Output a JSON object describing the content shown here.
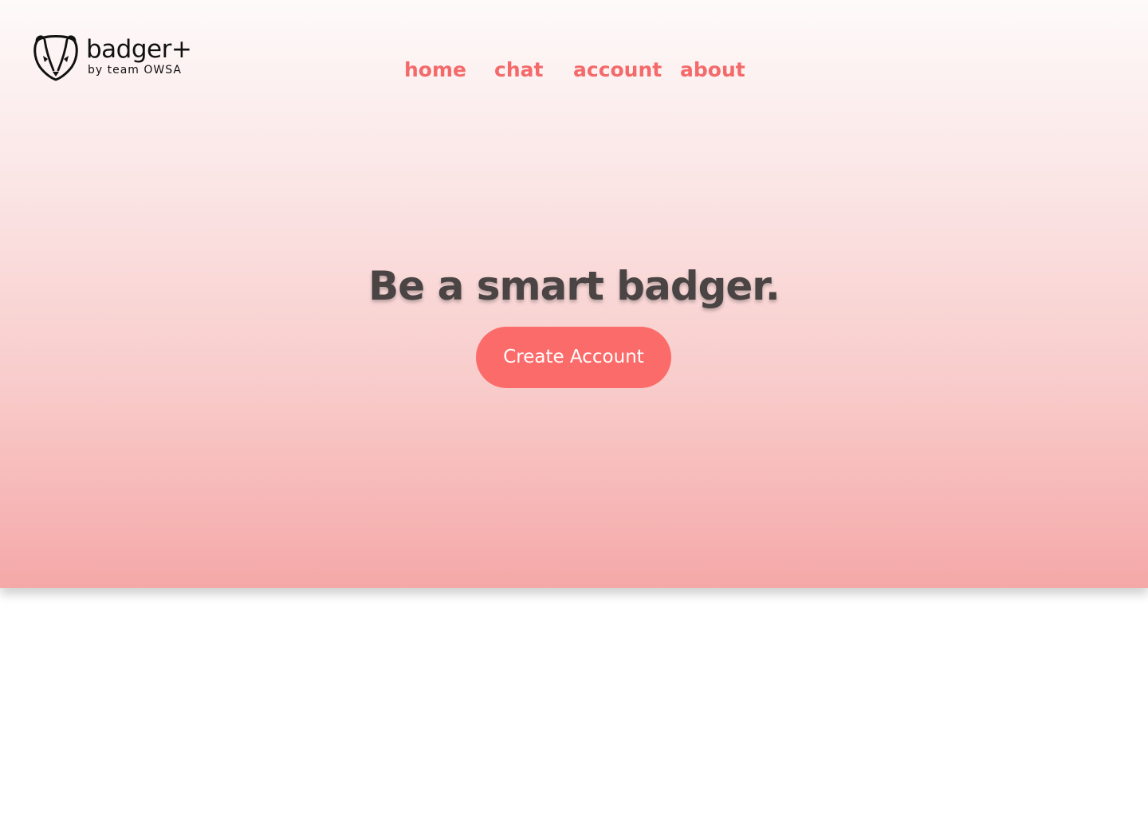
{
  "brand": {
    "name": "badger+",
    "tagline": "by team OWSA",
    "logo_icon": "badger-face-icon"
  },
  "nav": {
    "items": [
      {
        "label": "home"
      },
      {
        "label": "chat"
      },
      {
        "label": "account"
      },
      {
        "label": "about"
      }
    ]
  },
  "hero": {
    "headline": "Be a smart badger.",
    "cta_label": "Create Account"
  },
  "colors": {
    "accent": "#fb6b69",
    "nav_text": "#f46a6a",
    "headline_text": "#4b4444",
    "gradient_top": "#fefafa",
    "gradient_bottom": "#f5a8a8"
  }
}
